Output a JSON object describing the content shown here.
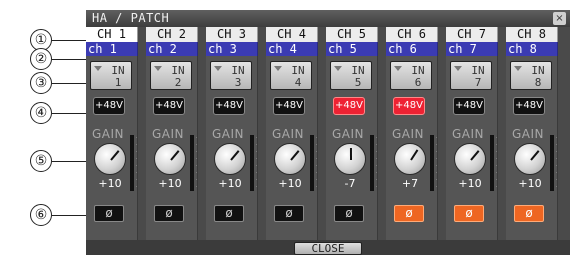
{
  "window": {
    "title": "HA / PATCH",
    "close_icon": "×"
  },
  "callouts": [
    "①",
    "②",
    "③",
    "④",
    "⑤",
    "⑥"
  ],
  "channels": [
    {
      "header": "CH 1",
      "name": "ch 1",
      "input_label": "IN",
      "input_number": "1",
      "phantom": "+48V",
      "phantom_on": false,
      "gain_label": "GAIN",
      "gain": "+10",
      "phase": "ø",
      "phase_on": false,
      "selected": true
    },
    {
      "header": "CH 2",
      "name": "ch 2",
      "input_label": "IN",
      "input_number": "2",
      "phantom": "+48V",
      "phantom_on": false,
      "gain_label": "GAIN",
      "gain": "+10",
      "phase": "ø",
      "phase_on": false,
      "selected": false
    },
    {
      "header": "CH 3",
      "name": "ch 3",
      "input_label": "IN",
      "input_number": "3",
      "phantom": "+48V",
      "phantom_on": false,
      "gain_label": "GAIN",
      "gain": "+10",
      "phase": "ø",
      "phase_on": false,
      "selected": false
    },
    {
      "header": "CH 4",
      "name": "ch 4",
      "input_label": "IN",
      "input_number": "4",
      "phantom": "+48V",
      "phantom_on": false,
      "gain_label": "GAIN",
      "gain": "+10",
      "phase": "ø",
      "phase_on": false,
      "selected": false
    },
    {
      "header": "CH 5",
      "name": "ch 5",
      "input_label": "IN",
      "input_number": "5",
      "phantom": "+48V",
      "phantom_on": true,
      "gain_label": "GAIN",
      "gain": "-7",
      "phase": "ø",
      "phase_on": false,
      "selected": false
    },
    {
      "header": "CH 6",
      "name": "ch 6",
      "input_label": "IN",
      "input_number": "6",
      "phantom": "+48V",
      "phantom_on": true,
      "gain_label": "GAIN",
      "gain": "+7",
      "phase": "ø",
      "phase_on": true,
      "selected": false
    },
    {
      "header": "CH 7",
      "name": "ch 7",
      "input_label": "IN",
      "input_number": "7",
      "phantom": "+48V",
      "phantom_on": false,
      "gain_label": "GAIN",
      "gain": "+10",
      "phase": "ø",
      "phase_on": true,
      "selected": false
    },
    {
      "header": "CH 8",
      "name": "ch 8",
      "input_label": "IN",
      "input_number": "8",
      "phantom": "+48V",
      "phantom_on": false,
      "gain_label": "GAIN",
      "gain": "+10",
      "phase": "ø",
      "phase_on": true,
      "selected": false
    }
  ],
  "footer": {
    "close_label": "CLOSE"
  },
  "colors": {
    "panel_bg": "#4a4a4a",
    "name_bg": "#3b3bb3",
    "phantom_on": "#ee2233",
    "phase_on": "#ee6622"
  }
}
